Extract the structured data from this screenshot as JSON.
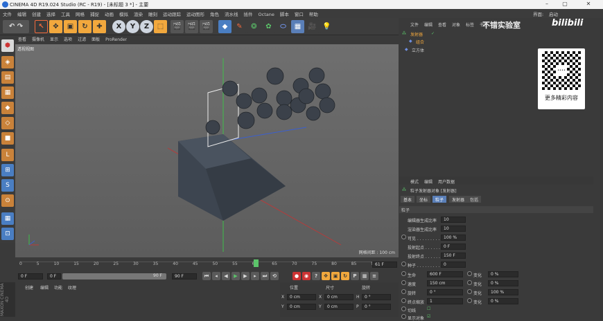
{
  "window": {
    "title": "CINEMA 4D R19.024 Studio (RC - R19) - [未标题 3 *] - 主要",
    "min": "–",
    "max": "▢",
    "close": "✕"
  },
  "menu": [
    "文件",
    "编辑",
    "创建",
    "选择",
    "工具",
    "网格",
    "捕捉",
    "动画",
    "模拟",
    "渲染",
    "雕刻",
    "运动跟踪",
    "运动图形",
    "角色",
    "流水线",
    "插件",
    "Octane",
    "脚本",
    "窗口",
    "帮助"
  ],
  "layout": {
    "label": "界面:",
    "value": "启动"
  },
  "toolbar": {
    "x": "X",
    "y": "Y",
    "z": "Z"
  },
  "viewport": {
    "menu": [
      "查看",
      "摄像机",
      "显示",
      "选项",
      "过滤",
      "面板",
      "ProRender"
    ],
    "label": "透视视图",
    "grid_spacing": "网格间距 : 100 cm"
  },
  "timeline": {
    "ticks": [
      "0",
      "5",
      "10",
      "15",
      "20",
      "25",
      "30",
      "35",
      "40",
      "45",
      "50",
      "55",
      "60",
      "65",
      "70",
      "75",
      "80",
      "85",
      "90"
    ],
    "current": "61",
    "end_label": "61 F"
  },
  "playbar": {
    "start": "0 F",
    "range_start": "0 F",
    "range_end": "90 F",
    "end": "90 F"
  },
  "bottom": {
    "menu": [
      "创建",
      "编辑",
      "功能",
      "纹理"
    ],
    "cols": [
      "位置",
      "尺寸",
      "旋转"
    ],
    "x_pos": "0 cm",
    "x_size": "0 cm",
    "h_rot": "0 °",
    "y_pos": "0 cm",
    "y_size": "0 cm",
    "p_rot": "0 °",
    "side_text": "MAXON CINEMA 4D"
  },
  "objects": {
    "menu": [
      "文件",
      "编辑",
      "查看",
      "对象",
      "标签",
      "书签"
    ],
    "items": [
      {
        "name": "发射器"
      },
      {
        "name": "立方体"
      }
    ],
    "child": "组合"
  },
  "watermark": {
    "title": "不错实验室",
    "brand": "bilibili",
    "qr_caption": "更多精彩内容",
    "qr_center": "••••"
  },
  "attributes": {
    "menu": [
      "模式",
      "编辑",
      "用户数据"
    ],
    "title": "粒子发射器对象 [发射器]",
    "tabs": [
      "基本",
      "坐标",
      "粒子",
      "发射器",
      "包括"
    ],
    "section": "粒子",
    "rows": [
      {
        "label": "编辑器生成比率",
        "value": "10"
      },
      {
        "label": "渲染器生成比率",
        "value": "10"
      },
      {
        "label": "可见 . . . . . . . . .",
        "value": "100 %"
      },
      {
        "label": "投射起点 . . . . . .",
        "value": "0 F"
      },
      {
        "label": "投射终点 . . . . . .",
        "value": "150 F"
      },
      {
        "label": "种子 . . . . . . . . .",
        "value": "0"
      }
    ],
    "pairs": [
      {
        "label": "生命",
        "value": "600 F",
        "vlabel": "变化",
        "vvalue": "0 %"
      },
      {
        "label": "速度",
        "value": "150 cm",
        "vlabel": "变化",
        "vvalue": "0 %"
      },
      {
        "label": "旋转",
        "value": "0 °",
        "vlabel": "变化",
        "vvalue": "100 %"
      },
      {
        "label": "终点缩放",
        "value": "1",
        "vlabel": "变化",
        "vvalue": "0 %"
      }
    ],
    "tangential": "切线",
    "show_objects": "显示对象"
  }
}
